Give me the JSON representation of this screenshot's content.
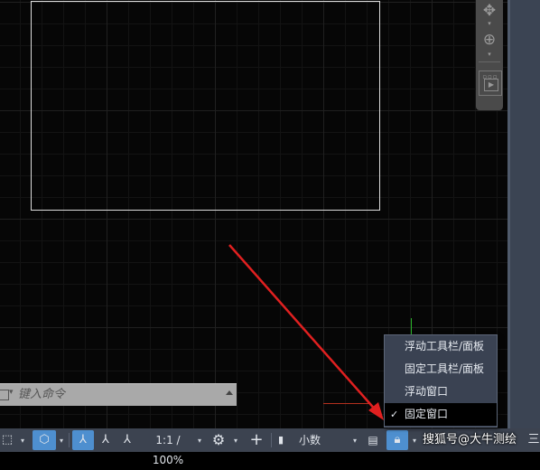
{
  "command_line": {
    "placeholder": "键入命令"
  },
  "context_menu": {
    "items": [
      {
        "label": "浮动工具栏/面板",
        "checked": false
      },
      {
        "label": "固定工具栏/面板",
        "checked": false
      },
      {
        "label": "浮动窗口",
        "checked": false
      },
      {
        "label": "固定窗口",
        "checked": true
      }
    ],
    "check_glyph": "✓"
  },
  "status_bar": {
    "annotation_scale": "1:1 / 100%",
    "units": "小数",
    "menu_glyph": "三"
  },
  "watermark": {
    "text": "搜狐号@大牛测绘"
  },
  "colors": {
    "canvas": "#060606",
    "status_bar": "#3c4350",
    "active_button": "#4e8fcf",
    "arrow": "#e02020",
    "y_axis": "#2ab42a",
    "x_axis": "#b4301e"
  }
}
